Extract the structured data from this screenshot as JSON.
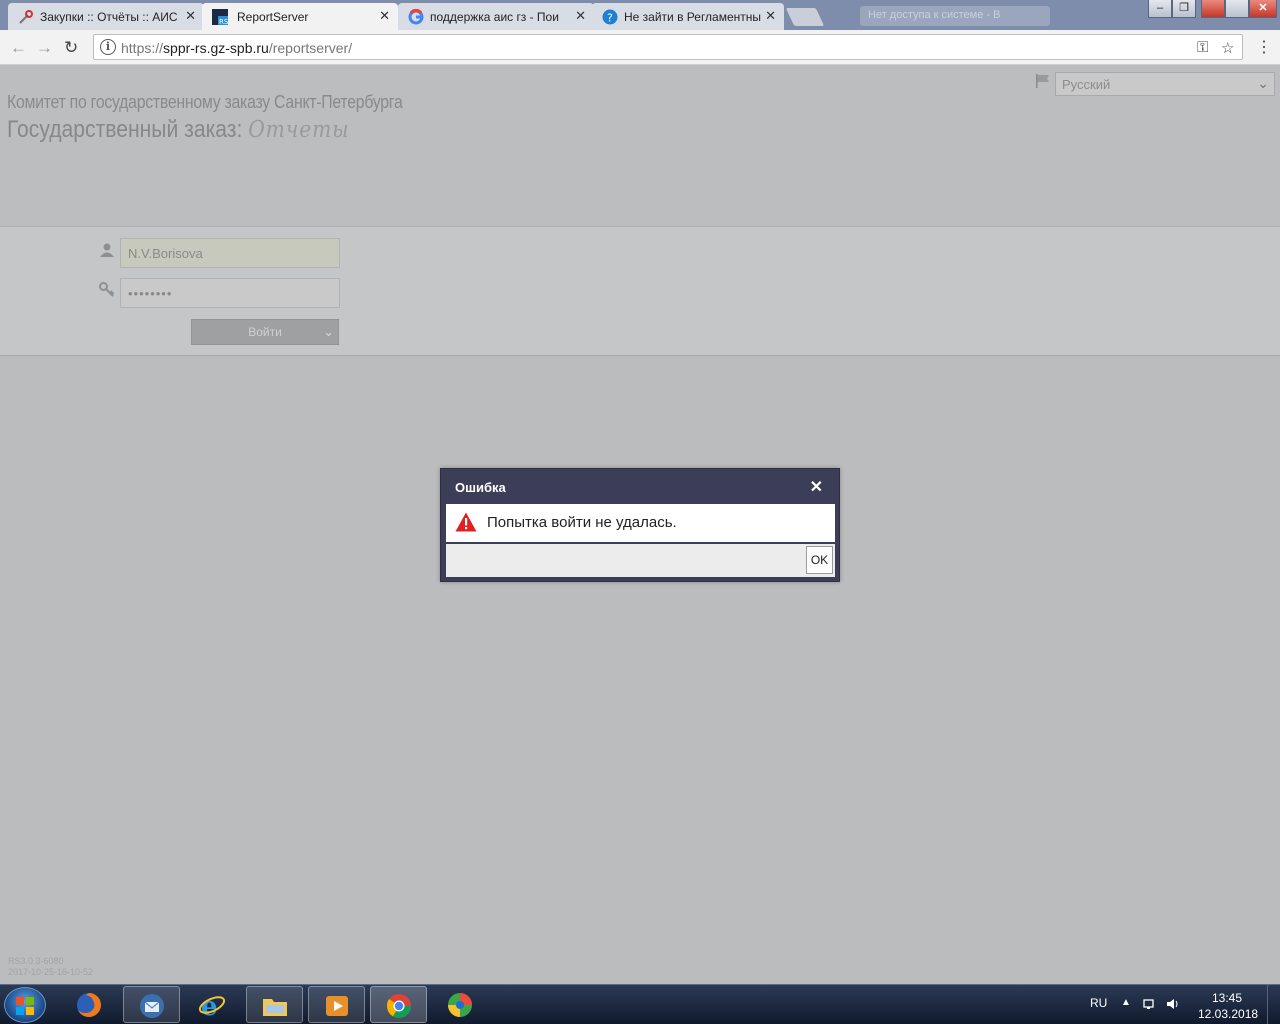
{
  "browser": {
    "tabs": [
      {
        "label": "Закупки :: Отчёты :: АИС",
        "icon": "tools-icon"
      },
      {
        "label": "ReportServer",
        "icon": "rs-icon",
        "active": true
      },
      {
        "label": "поддержка аис гз - Пои",
        "icon": "google-icon"
      },
      {
        "label": "Не зайти в Регламентны",
        "icon": "help-icon"
      }
    ],
    "ghost_tab": "Нет доступа к системе - В",
    "url_host": "sppr-rs.gz-spb.ru",
    "url_scheme": "https://",
    "url_path": "/reportserver/",
    "window_controls": {
      "minimize": "–",
      "maximize": "❐",
      "close": "✕"
    }
  },
  "header": {
    "org_name": "Комитет по государственному заказу Санкт-Петербурга",
    "app_title": "Государственный заказ:",
    "app_title_script": "Отчеты",
    "language": "Русский"
  },
  "login": {
    "username": "N.V.Borisova",
    "password_mask": "••••••••",
    "login_button": "Войти"
  },
  "footer": {
    "version_line1": "RS3.0.3-6080",
    "version_line2": "2017-10-25-16-10-52"
  },
  "dialog": {
    "title": "Ошибка",
    "close": "✕",
    "message": "Попытка войти не удалась.",
    "ok": "OK"
  },
  "taskbar": {
    "language": "RU",
    "time": "13:45",
    "date": "12.03.2018"
  }
}
